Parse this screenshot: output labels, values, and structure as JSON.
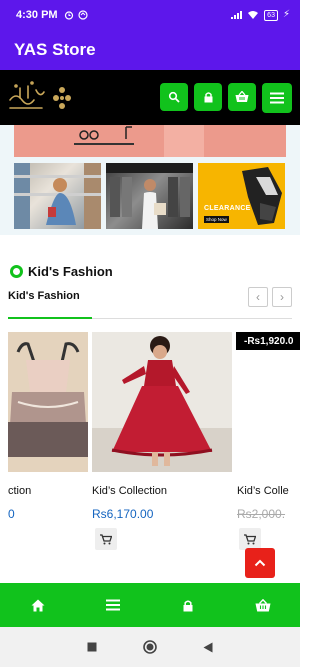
{
  "status_bar": {
    "time": "4:30 PM",
    "battery": "63"
  },
  "app": {
    "title": "YAS Store"
  },
  "header": {
    "logo_text": "بوتیس",
    "icons": [
      "search-icon",
      "lock-icon",
      "basket-icon",
      "menu-icon"
    ]
  },
  "banner": {
    "clearance": "CLEARANCE",
    "shop_now": "Shop Now"
  },
  "section": {
    "title": "Kid's Fashion",
    "tab_label": "Kid's Fashion",
    "prev_label": "‹",
    "next_label": "›"
  },
  "products": [
    {
      "name": "ction",
      "price": "0"
    },
    {
      "name": "Kid’s Collection",
      "price": "Rs6,170.00"
    },
    {
      "name": "Kid’s Colle",
      "old_price": "Rs2,000.",
      "sale_tag": "-Rs1,920.0"
    }
  ],
  "bottom_nav": [
    "home-icon",
    "menu-icon",
    "lock-icon",
    "basket-icon"
  ],
  "colors": {
    "purple": "#5d17eb",
    "green": "#11c21c",
    "red": "#e8211a",
    "price_blue": "#1565c0"
  }
}
